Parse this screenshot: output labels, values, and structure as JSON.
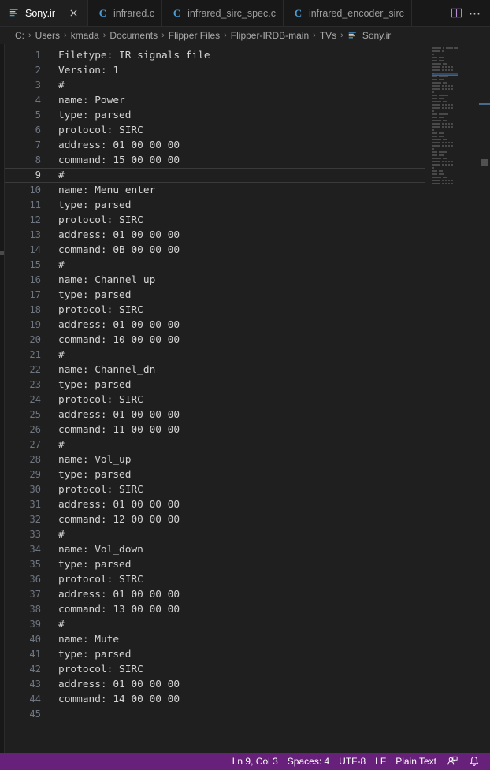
{
  "window": {
    "theme_bg": "#1f1f1f",
    "accent_status_bar": "#68217a"
  },
  "tabs": [
    {
      "label": "Sony.ir",
      "icon": "ir-file-icon",
      "active": true,
      "close_icon": "close-icon"
    },
    {
      "label": "infrared.c",
      "icon": "c-file-icon",
      "active": false
    },
    {
      "label": "infrared_sirc_spec.c",
      "icon": "c-file-icon",
      "active": false
    },
    {
      "label": "infrared_encoder_sirc",
      "icon": "c-file-icon",
      "active": false
    }
  ],
  "tab_actions": {
    "split_editor_icon": "split-editor-icon",
    "more_actions_label": "⋯"
  },
  "breadcrumb": {
    "separator": "›",
    "items": [
      {
        "label": "C:"
      },
      {
        "label": "Users"
      },
      {
        "label": "kmada"
      },
      {
        "label": "Documents"
      },
      {
        "label": "Flipper Files"
      },
      {
        "label": "Flipper-IRDB-main"
      },
      {
        "label": "TVs"
      },
      {
        "label": "Sony.ir",
        "icon": "ir-file-icon"
      }
    ]
  },
  "editor": {
    "current_line": 9,
    "total_lines": 45,
    "lines": [
      "Filetype: IR signals file",
      "Version: 1",
      "#",
      "name: Power",
      "type: parsed",
      "protocol: SIRC",
      "address: 01 00 00 00",
      "command: 15 00 00 00",
      "#",
      "name: Menu_enter",
      "type: parsed",
      "protocol: SIRC",
      "address: 01 00 00 00",
      "command: 0B 00 00 00",
      "#",
      "name: Channel_up",
      "type: parsed",
      "protocol: SIRC",
      "address: 01 00 00 00",
      "command: 10 00 00 00",
      "#",
      "name: Channel_dn",
      "type: parsed",
      "protocol: SIRC",
      "address: 01 00 00 00",
      "command: 11 00 00 00",
      "#",
      "name: Vol_up",
      "type: parsed",
      "protocol: SIRC",
      "address: 01 00 00 00",
      "command: 12 00 00 00",
      "#",
      "name: Vol_down",
      "type: parsed",
      "protocol: SIRC",
      "address: 01 00 00 00",
      "command: 13 00 00 00",
      "#",
      "name: Mute",
      "type: parsed",
      "protocol: SIRC",
      "address: 01 00 00 00",
      "command: 14 00 00 00",
      ""
    ]
  },
  "status_bar": {
    "cursor_position": "Ln 9, Col 3",
    "indentation": "Spaces: 4",
    "encoding": "UTF-8",
    "eol": "LF",
    "language_mode": "Plain Text",
    "feedback_icon": "feedback-smiley-icon",
    "notifications_icon": "bell-icon"
  }
}
